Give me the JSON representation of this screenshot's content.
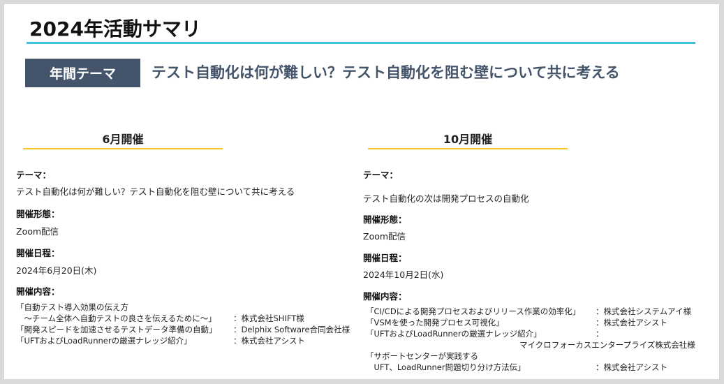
{
  "title": "2024年活動サマリ",
  "theme": {
    "badge": "年間テーマ",
    "text": "テスト自動化は何が難しい？テスト自動化を阻む壁について共に考える"
  },
  "sessions": [
    {
      "heading": "6月開催",
      "theme_label": "テーマ：",
      "theme_value": "テスト自動化は何が難しい？テスト自動化を阻む壁について共に考える",
      "format_label": "開催形態：",
      "format_value": "Zoom配信",
      "date_label": "開催日程：",
      "date_value": "2024年6月20日(木)",
      "content_label": "開催内容：",
      "program": [
        {
          "title": "「自動テスト導入効果の伝え方",
          "company": ""
        },
        {
          "title": "　～チーム全体へ自動テストの良さを伝えるために～」",
          "company": "：株式会社SHIFT様"
        },
        {
          "title": "「開発スピードを加速させるテストデータ準備の自動」",
          "company": "：Delphix Software合同会社様"
        },
        {
          "title": "「UFTおよびLoadRunnerの厳選ナレッジ紹介」",
          "company": "：株式会社アシスト"
        }
      ]
    },
    {
      "heading": "10月開催",
      "theme_label": "テーマ：",
      "theme_value": "テスト自動化の次は開発プロセスの自動化",
      "format_label": "開催形態：",
      "format_value": "Zoom配信",
      "date_label": "開催日程：",
      "date_value": "2024年10月2日(水)",
      "content_label": "開催内容：",
      "program": [
        {
          "title": "「CI/CDによる開発プロセスおよびリリース作業の効率化」",
          "company": "：株式会社システムアイ様"
        },
        {
          "title": "「VSMを使った開発プロセス可視化」",
          "company": "：株式会社アシスト"
        },
        {
          "title": "「UFTおよびLoadRunnerの厳選ナレッジ紹介」",
          "company": "："
        },
        {
          "title": "",
          "company": "マイクロフォーカスエンタープライズ株式会社様"
        },
        {
          "title": "「サポートセンターが実践する",
          "company": ""
        },
        {
          "title": "　UFT、LoadRunner問題切り分け方法伝」",
          "company": "：株式会社アシスト"
        }
      ]
    }
  ]
}
